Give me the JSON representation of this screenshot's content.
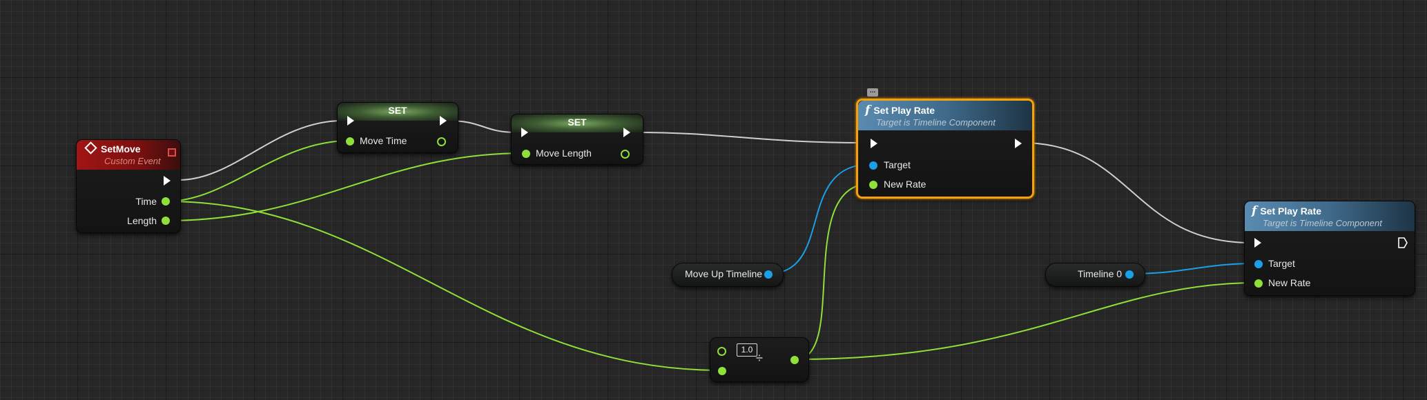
{
  "nodes": {
    "setmove": {
      "title": "SetMove",
      "subtitle": "Custom Event",
      "pins": {
        "time": "Time",
        "length": "Length"
      }
    },
    "set1": {
      "title": "SET",
      "pin": "Move Time"
    },
    "set2": {
      "title": "SET",
      "pin": "Move Length"
    },
    "setplayrate1": {
      "title": "Set Play Rate",
      "subtitle": "Target is Timeline Component",
      "target": "Target",
      "new_rate": "New Rate"
    },
    "setplayrate2": {
      "title": "Set Play Rate",
      "subtitle": "Target is Timeline Component",
      "target": "Target",
      "new_rate": "New Rate"
    },
    "moveup_var": {
      "label": "Move Up Timeline"
    },
    "timeline0_var": {
      "label": "Timeline 0"
    },
    "divide": {
      "value": "1.0",
      "op_symbol": "÷"
    }
  },
  "colors": {
    "exec_wire": "#cfcfcf",
    "float_wire": "#8fe03a",
    "object_wire": "#1ba0e8",
    "selection": "#f5a20d",
    "event_header": "#a11515",
    "function_header": "#5a8bb0"
  },
  "icons": {
    "function": "function-f-icon",
    "event": "event-diamond-icon",
    "comment": "comment-bubble-icon"
  }
}
